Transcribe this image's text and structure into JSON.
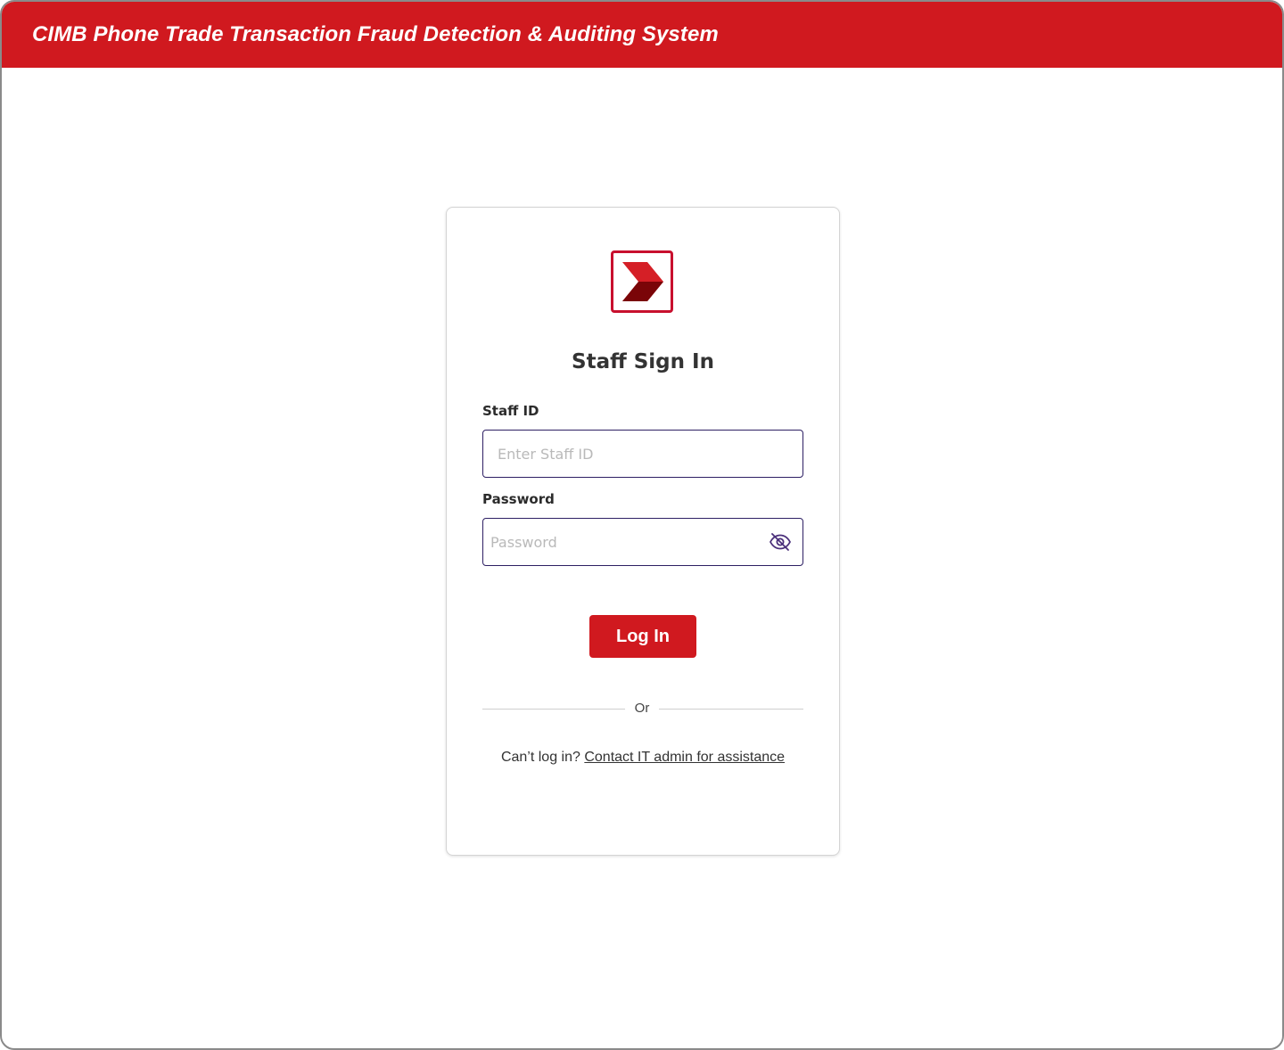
{
  "header": {
    "title": "CIMB Phone Trade Transaction Fraud Detection & Auditing System"
  },
  "login": {
    "logo_icon": "cimb-chevron-logo-icon",
    "title": "Staff Sign In",
    "staff_id": {
      "label": "Staff ID",
      "placeholder": "Enter Staff ID",
      "value": ""
    },
    "password": {
      "label": "Password",
      "placeholder": "Password",
      "value": "",
      "toggle_icon": "eye-off-icon"
    },
    "submit_label": "Log In",
    "divider_text": "Or",
    "help_text": "Can’t log in?",
    "help_link": "Contact IT admin for assistance"
  },
  "colors": {
    "brand_red": "#d0191f",
    "logo_red": "#c8102e",
    "input_border": "#2d1f63"
  }
}
